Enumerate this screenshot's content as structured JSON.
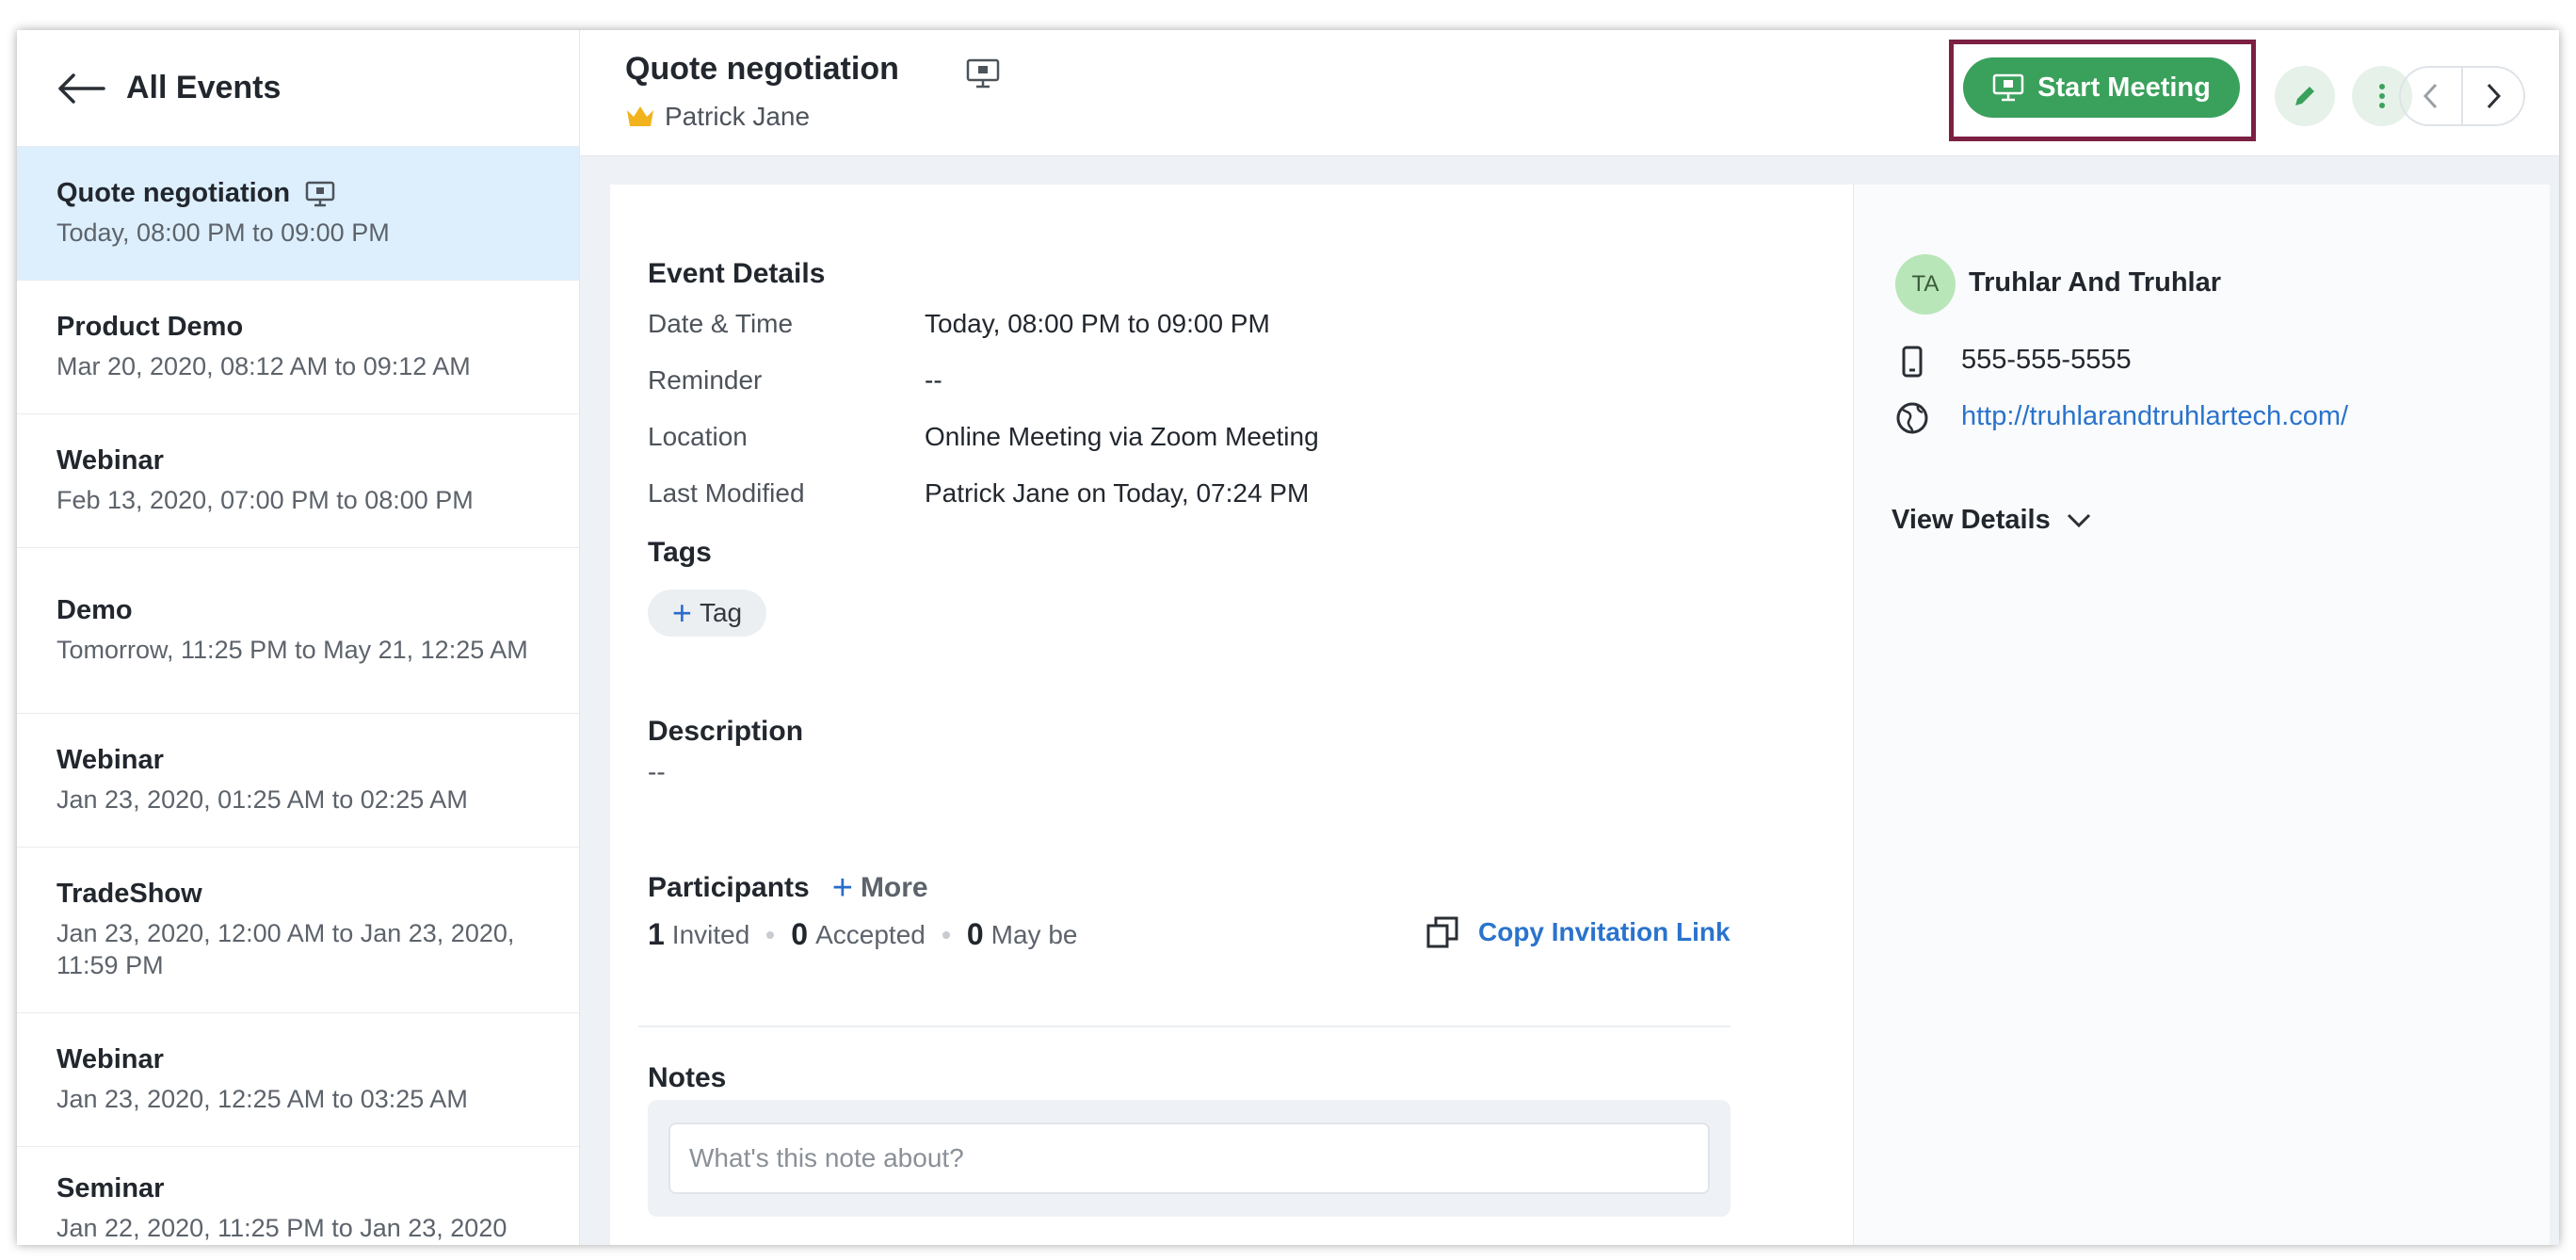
{
  "sidebar": {
    "title": "All Events",
    "events": [
      {
        "name": "Quote negotiation",
        "time": "Today, 08:00 PM to 09:00 PM"
      },
      {
        "name": "Product Demo",
        "time": "Mar 20, 2020, 08:12 AM to 09:12 AM"
      },
      {
        "name": "Webinar",
        "time": "Feb 13, 2020, 07:00 PM to 08:00 PM"
      },
      {
        "name": "Demo",
        "time": "Tomorrow, 11:25 PM to May 21, 12:25 AM"
      },
      {
        "name": "Webinar",
        "time": "Jan 23, 2020, 01:25 AM to 02:25 AM"
      },
      {
        "name": "TradeShow",
        "time": "Jan 23, 2020, 12:00 AM to Jan 23, 2020, 11:59 PM"
      },
      {
        "name": "Webinar",
        "time": "Jan 23, 2020, 12:25 AM to 03:25 AM"
      },
      {
        "name": "Seminar",
        "time": "Jan 22, 2020, 11:25 PM to Jan 23, 2020"
      }
    ]
  },
  "header": {
    "title": "Quote negotiation",
    "owner": "Patrick Jane",
    "start_meeting": "Start Meeting"
  },
  "details": {
    "section": "Event Details",
    "rows": [
      {
        "label": "Date & Time",
        "value": "Today, 08:00 PM to 09:00 PM"
      },
      {
        "label": "Reminder",
        "value": "--"
      },
      {
        "label": "Location",
        "value": "Online Meeting via Zoom Meeting"
      },
      {
        "label": "Last Modified",
        "value": "Patrick Jane on Today, 07:24 PM"
      }
    ]
  },
  "tags": {
    "section": "Tags",
    "add_label": "Tag"
  },
  "description": {
    "section": "Description",
    "value": "--"
  },
  "participants": {
    "section": "Participants",
    "more_label": "More",
    "invited_count": "1",
    "invited_label": "Invited",
    "accepted_count": "0",
    "accepted_label": "Accepted",
    "maybe_count": "0",
    "maybe_label": "May be",
    "copy_link": "Copy Invitation Link"
  },
  "notes": {
    "section": "Notes",
    "placeholder": "What's this note about?"
  },
  "account": {
    "initials": "TA",
    "name": "Truhlar And Truhlar",
    "phone": "555-555-5555",
    "website": "http://truhlarandtruhlartech.com/",
    "view_details": "View Details"
  },
  "colors": {
    "accent_green": "#3aa15c",
    "highlight_border": "#7b1f43",
    "link_blue": "#2a73cc",
    "active_row": "#ddeffd"
  }
}
